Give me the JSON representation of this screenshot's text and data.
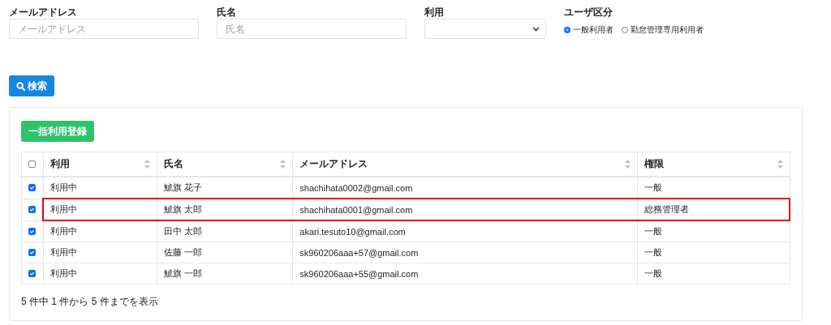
{
  "filters": {
    "email": {
      "label": "メールアドレス",
      "placeholder": "メールアドレス"
    },
    "name": {
      "label": "氏名",
      "placeholder": "氏名"
    },
    "usage": {
      "label": "利用"
    },
    "user_type": {
      "label": "ユーザ区分",
      "options": [
        {
          "label": "一般利用者",
          "selected": true
        },
        {
          "label": "勤怠管理専用利用者",
          "selected": false
        }
      ]
    }
  },
  "search_button": "検索",
  "bulk_button": "一括利用登録",
  "table": {
    "select_all_checked": false,
    "columns": [
      "利用",
      "氏名",
      "メールアドレス",
      "権限"
    ],
    "rows": [
      {
        "checked": true,
        "highlighted": false,
        "cells": [
          "利用中",
          "鯱旗 花子",
          "shachihata0002@gmail.com",
          "一般"
        ]
      },
      {
        "checked": true,
        "highlighted": true,
        "cells": [
          "利用中",
          "鯱旗 太郎",
          "shachihata0001@gmail.com",
          "総務管理者"
        ]
      },
      {
        "checked": true,
        "highlighted": false,
        "cells": [
          "利用中",
          "田中 太郎",
          "akari.tesuto10@gmail.com",
          "一般"
        ]
      },
      {
        "checked": true,
        "highlighted": false,
        "cells": [
          "利用中",
          "佐藤 一郎",
          "sk960206aaa+57@gmail.com",
          "一般"
        ]
      },
      {
        "checked": true,
        "highlighted": false,
        "cells": [
          "利用中",
          "鯱旗 一郎",
          "sk960206aaa+55@gmail.com",
          "一般"
        ]
      }
    ]
  },
  "footer": "5 件中 1 件から 5 件までを表示"
}
